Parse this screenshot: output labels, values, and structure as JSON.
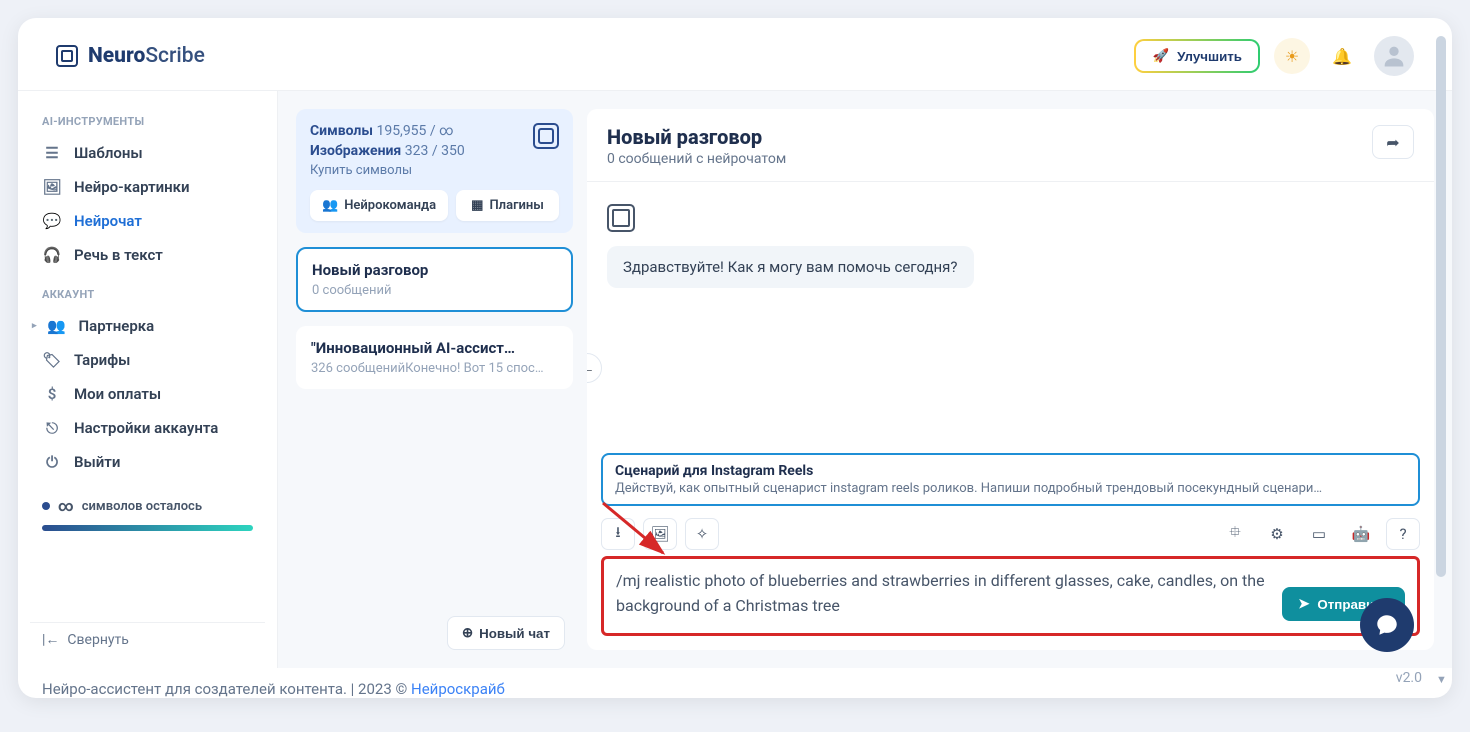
{
  "header": {
    "brand_pre": "Neuro",
    "brand_post": "Scribe",
    "improve_label": "Улучшить"
  },
  "sidebar": {
    "section1_label": "AI-ИНСТРУМЕНТЫ",
    "items1": [
      {
        "label": "Шаблоны"
      },
      {
        "label": "Нейро-картинки"
      },
      {
        "label": "Нейрочат"
      },
      {
        "label": "Речь в текст"
      }
    ],
    "section2_label": "АККАУНТ",
    "items2": [
      {
        "label": "Партнерка"
      },
      {
        "label": "Тарифы"
      },
      {
        "label": "Мои оплаты"
      },
      {
        "label": "Настройки аккаунта"
      },
      {
        "label": "Выйти"
      }
    ],
    "symbols_left_prefix": "∞",
    "symbols_left_label": "символов осталось",
    "collapse_label": "Свернуть"
  },
  "leftcol": {
    "symbols_label": "Символы",
    "symbols_value": "195,955 / ∞",
    "images_label": "Изображения",
    "images_value": "323 / 350",
    "buy_label": "Купить символы",
    "neuroteam_label": "Нейрокоманда",
    "plugins_label": "Плагины",
    "conversations": [
      {
        "title": "Новый разговор",
        "sub": "0 сообщений",
        "active": true
      },
      {
        "title": "\"Инновационный AI-ассист…",
        "sub": "326 сообщенийКонечно! Вот 15 спос…",
        "active": false
      }
    ],
    "new_chat_label": "Новый чат"
  },
  "chat": {
    "title": "Новый разговор",
    "sub": "0 сообщений с нейрочатом",
    "greeting": "Здравствуйте! Как я могу вам помочь сегодня?",
    "prompt_title": "Сценарий для Instagram Reels",
    "prompt_sub": "Действуй, как опытный сценарист instagram reels роликов. Напиши подробный трендовый посекундный сценари…",
    "input_text": "/mj realistic photo of blueberries and strawberries in different glasses, cake, candles, on the background of a Christmas tree",
    "send_label": "Отправить"
  },
  "footer": {
    "text": "Нейро-ассистент для создателей контента.  | 2023 © ",
    "link": "Нейроскрайб",
    "version": "v2.0"
  }
}
